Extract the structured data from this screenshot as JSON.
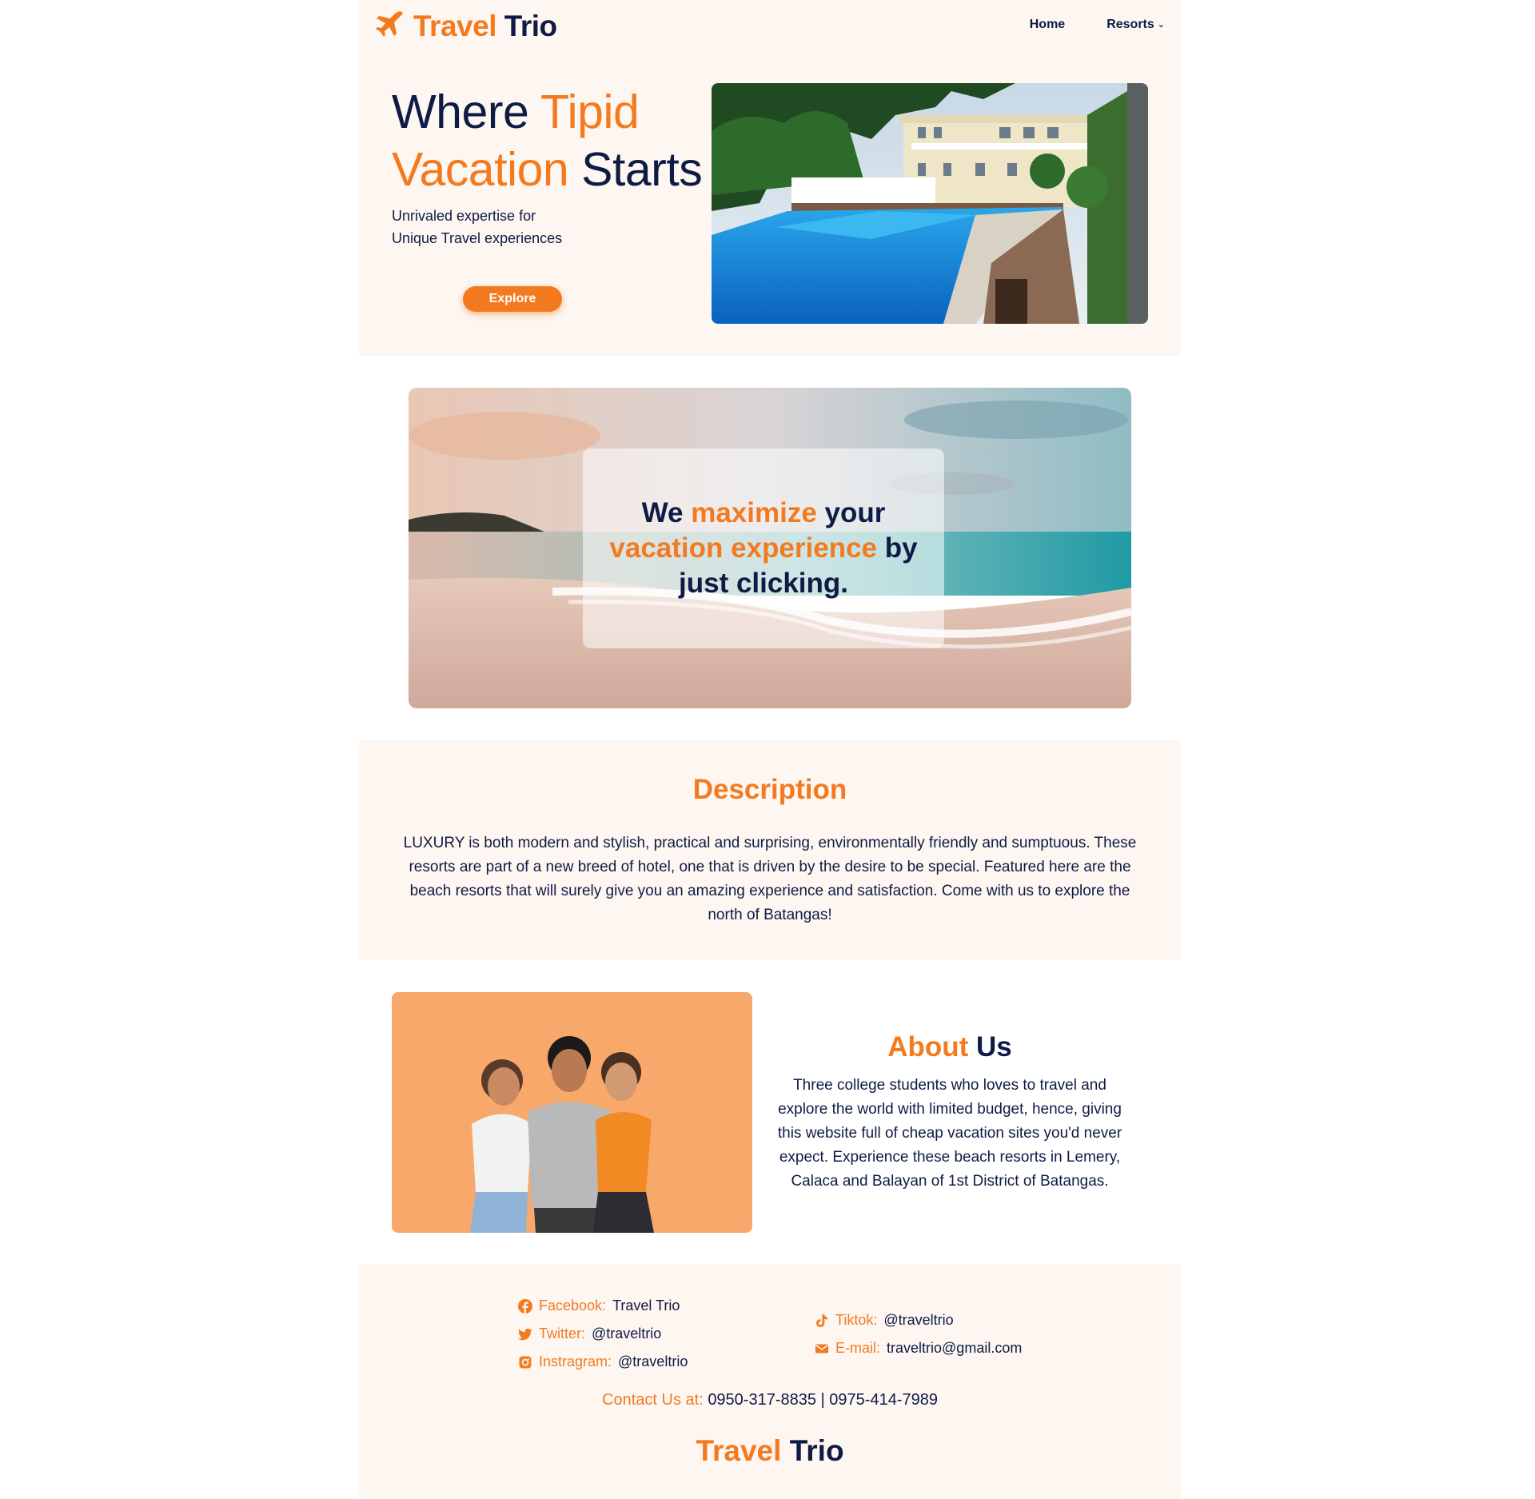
{
  "brand": {
    "first": "Travel",
    "second": "Trio"
  },
  "nav": {
    "home": "Home",
    "resorts": "Resorts"
  },
  "hero": {
    "title_1": "Where ",
    "title_2": "Tipid",
    "title_3": "Vacation",
    "title_4": " Starts",
    "subtitle_1": "Unrivaled expertise for",
    "subtitle_2": "Unique Travel experiences",
    "button": "Explore"
  },
  "banner": {
    "p1": "We ",
    "p2": "maximize",
    "p3": " your ",
    "p4": "vacation experience",
    "p5": " by just clicking."
  },
  "description": {
    "title": "Description",
    "body": "LUXURY is both modern and stylish, practical and surprising, environmentally friendly and sumptuous. These resorts are part of a new breed of hotel, one that is driven by the desire to be special. Featured here are the beach resorts that will surely give you an amazing experience and satisfaction. Come with us to explore the north of Batangas!"
  },
  "about": {
    "title_1": "About",
    "title_2": " Us",
    "body": "Three college students who loves to travel and explore the world with limited budget, hence, giving this website full of cheap vacation sites you'd never expect. Experience these beach resorts in Lemery, Calaca and Balayan of 1st District of Batangas."
  },
  "footer": {
    "facebook_label": "Facebook:",
    "facebook_value": "Travel Trio",
    "twitter_label": "Twitter:",
    "twitter_value": "@traveltrio",
    "instagram_label": "Instragram:",
    "instagram_value": "@traveltrio",
    "tiktok_label": "Tiktok:",
    "tiktok_value": "@traveltrio",
    "email_label": "E-mail:",
    "email_value": "traveltrio@gmail.com",
    "contact_label": "Contact Us at:",
    "contact_value": "0950-317-8835 | 0975-414-7989"
  },
  "icons": {
    "logo": "airplane-icon",
    "nav_resorts": "chevron-down-icon",
    "facebook": "facebook-icon",
    "twitter": "twitter-icon",
    "instagram": "instagram-icon",
    "tiktok": "tiktok-icon",
    "email": "mail-icon"
  },
  "colors": {
    "accent": "#f47a20",
    "navy": "#0f1b45",
    "section_bg": "#fdf6f1",
    "about_bg": "#f9a86c"
  }
}
